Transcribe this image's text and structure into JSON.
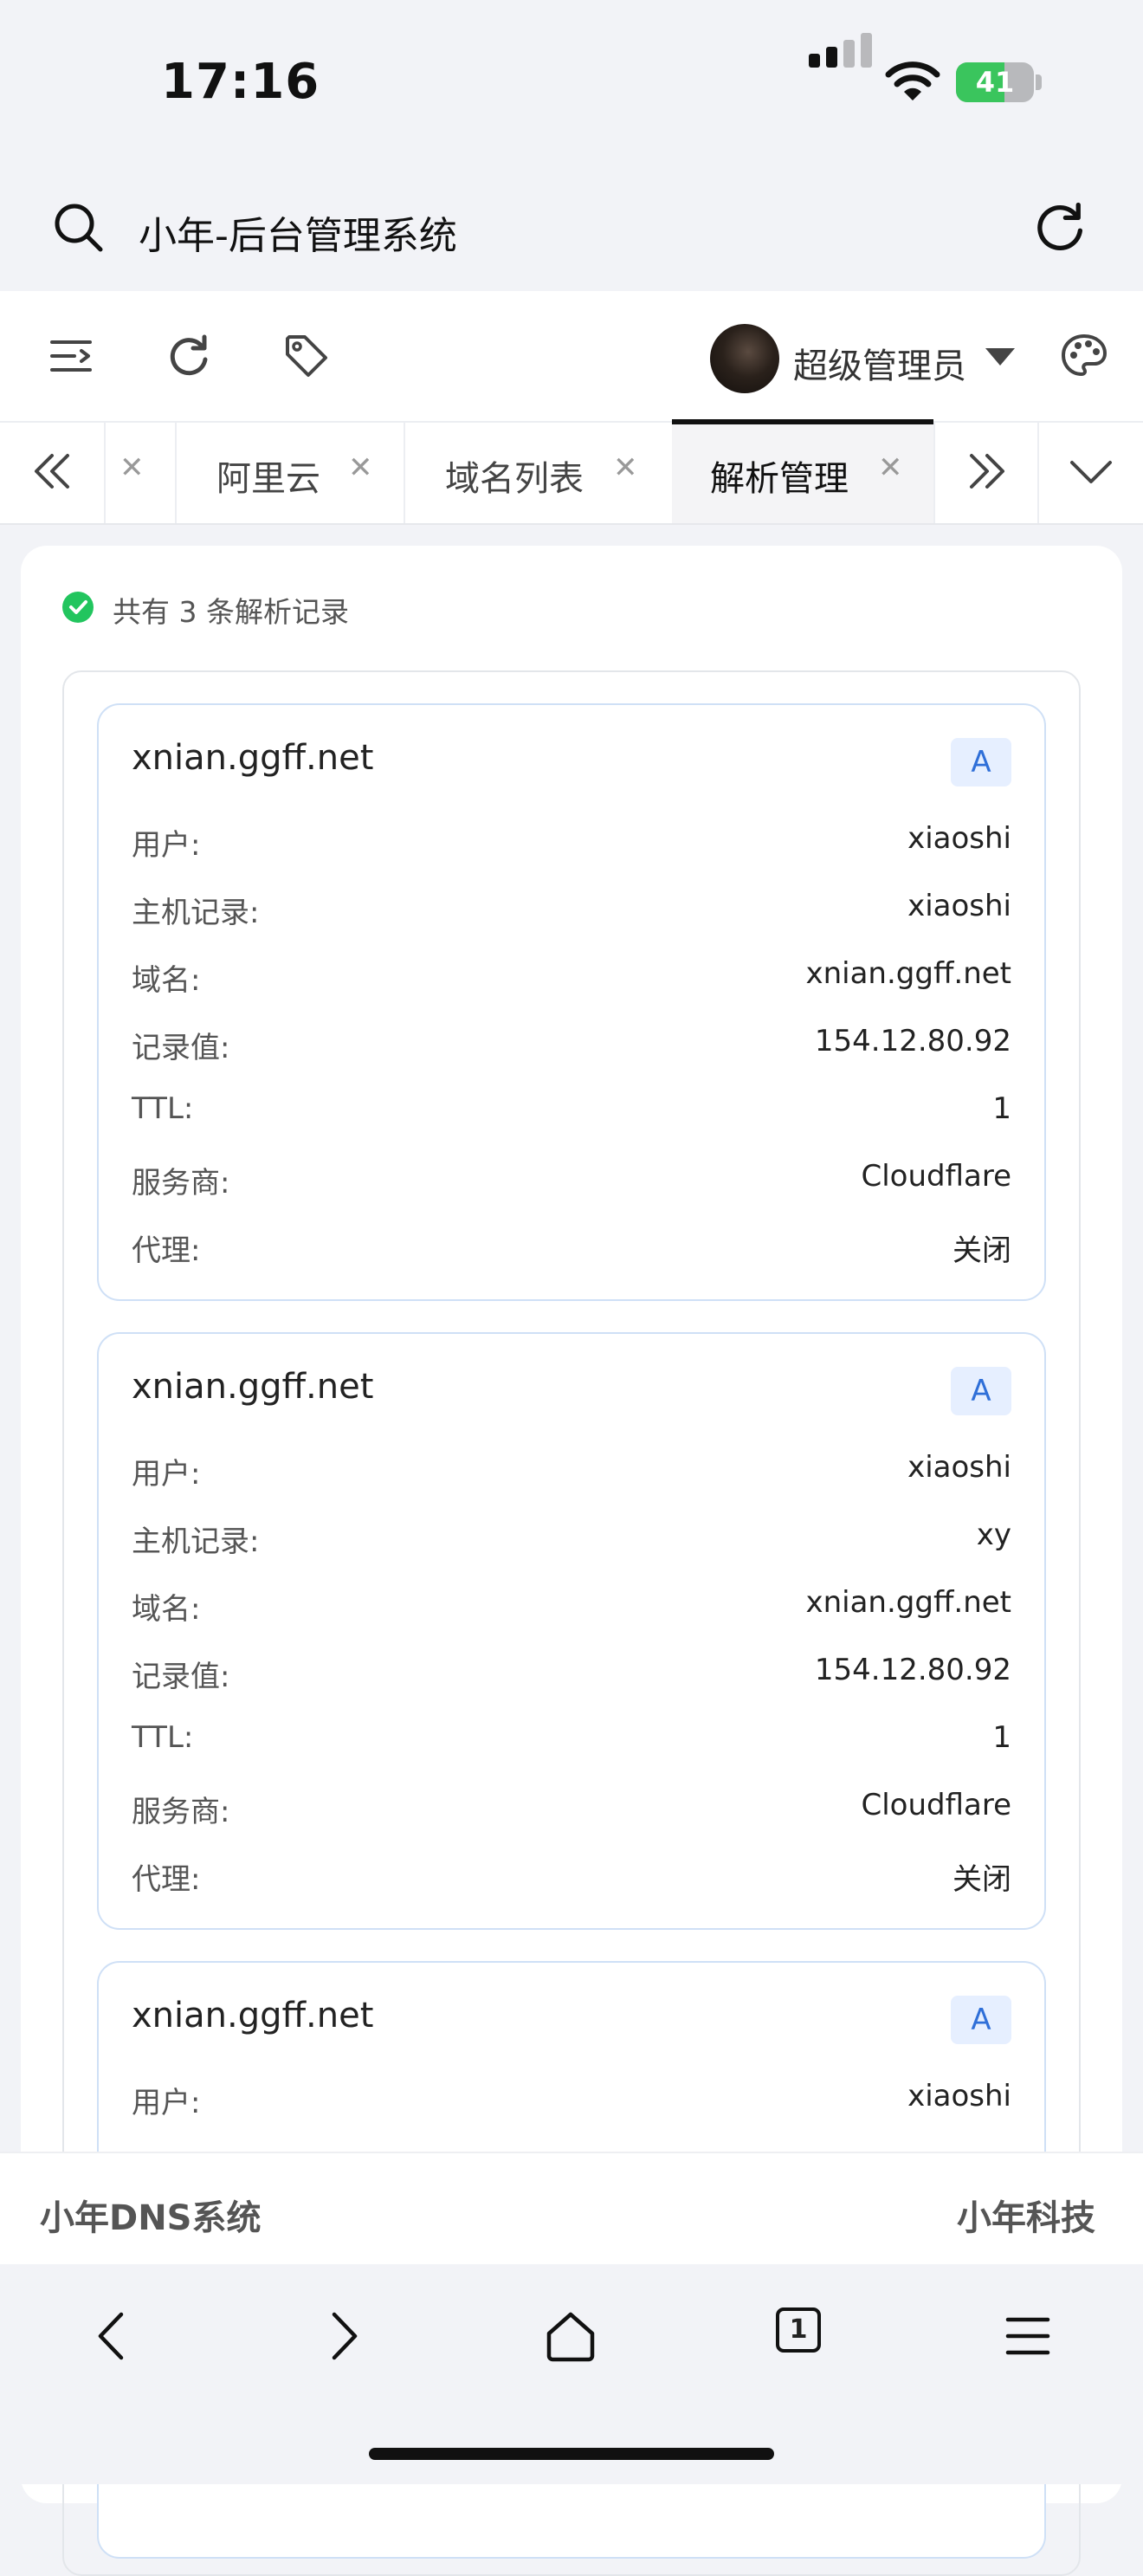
{
  "status_bar": {
    "time": "17:16",
    "battery": "41"
  },
  "browser": {
    "title": "小年-后台管理系统"
  },
  "header": {
    "user_name": "超级管理员"
  },
  "tabs": [
    {
      "label": "",
      "active": false
    },
    {
      "label": "阿里云",
      "active": false
    },
    {
      "label": "域名列表",
      "active": false
    },
    {
      "label": "解析管理",
      "active": true
    }
  ],
  "summary": {
    "text": "共有 3 条解析记录"
  },
  "records": [
    {
      "title": "xnian.ggff.net",
      "type": "A",
      "rows": [
        {
          "k": "用户:",
          "v": "xiaoshi"
        },
        {
          "k": "主机记录:",
          "v": "xiaoshi"
        },
        {
          "k": "域名:",
          "v": "xnian.ggff.net"
        },
        {
          "k": "记录值:",
          "v": "154.12.80.92"
        },
        {
          "k": "TTL:",
          "v": "1"
        },
        {
          "k": "服务商:",
          "v": "Cloudflare"
        },
        {
          "k": "代理:",
          "v": "关闭"
        }
      ]
    },
    {
      "title": "xnian.ggff.net",
      "type": "A",
      "rows": [
        {
          "k": "用户:",
          "v": "xiaoshi"
        },
        {
          "k": "主机记录:",
          "v": "xy"
        },
        {
          "k": "域名:",
          "v": "xnian.ggff.net"
        },
        {
          "k": "记录值:",
          "v": "154.12.80.92"
        },
        {
          "k": "TTL:",
          "v": "1"
        },
        {
          "k": "服务商:",
          "v": "Cloudflare"
        },
        {
          "k": "代理:",
          "v": "关闭"
        }
      ]
    },
    {
      "title": "xnian.ggff.net",
      "type": "A",
      "rows": [
        {
          "k": "用户:",
          "v": "xiaoshi"
        }
      ]
    }
  ],
  "footer": {
    "left": "小年DNS系统",
    "right": "小年科技"
  },
  "bottom_nav": {
    "tabs_count": "1"
  }
}
